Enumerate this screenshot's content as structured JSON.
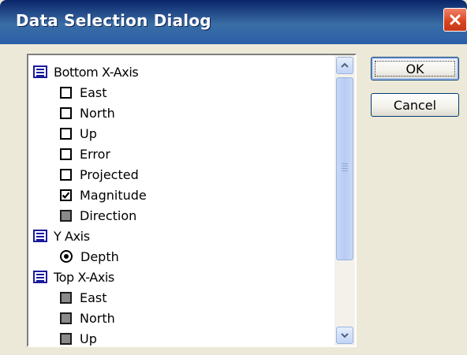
{
  "dialog": {
    "title": "Data Selection Dialog",
    "close_icon": "close-x-icon"
  },
  "colors": {
    "titlebar": "#2B5EA8",
    "close_button": "#D9421D",
    "dialog_bg": "#ECE9D8",
    "header_icon": "#1A1A9C",
    "checkbox_disabled": "#8A8A8A"
  },
  "list": {
    "groups": [
      {
        "label": "Bottom X-Axis",
        "icon": "list-group-icon",
        "items": [
          {
            "label": "East",
            "control": "checkbox",
            "state": "unchecked"
          },
          {
            "label": "North",
            "control": "checkbox",
            "state": "unchecked"
          },
          {
            "label": "Up",
            "control": "checkbox",
            "state": "unchecked"
          },
          {
            "label": "Error",
            "control": "checkbox",
            "state": "unchecked"
          },
          {
            "label": "Projected",
            "control": "checkbox",
            "state": "unchecked"
          },
          {
            "label": "Magnitude",
            "control": "checkbox",
            "state": "checked"
          },
          {
            "label": "Direction",
            "control": "checkbox",
            "state": "disabled"
          }
        ]
      },
      {
        "label": "Y Axis",
        "icon": "list-group-icon",
        "items": [
          {
            "label": "Depth",
            "control": "radio",
            "state": "selected"
          }
        ]
      },
      {
        "label": "Top X-Axis",
        "icon": "list-group-icon",
        "items": [
          {
            "label": "East",
            "control": "checkbox",
            "state": "disabled"
          },
          {
            "label": "North",
            "control": "checkbox",
            "state": "disabled"
          },
          {
            "label": "Up",
            "control": "checkbox",
            "state": "disabled"
          }
        ]
      }
    ]
  },
  "buttons": {
    "ok_label": "OK",
    "cancel_label": "Cancel"
  }
}
